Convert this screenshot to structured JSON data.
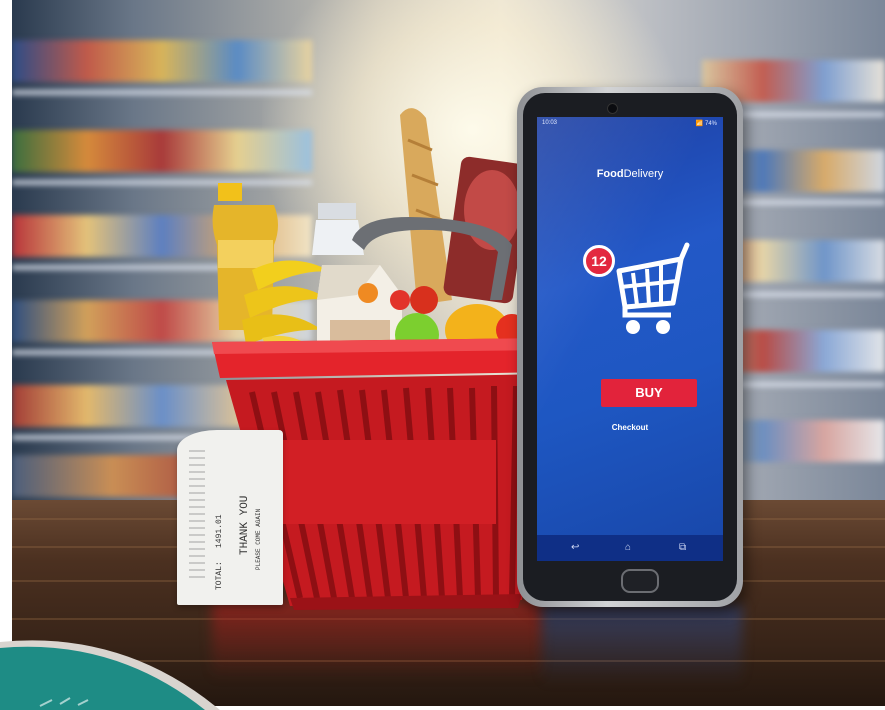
{
  "phone_screen": {
    "status_time": "10:03",
    "status_icons": "📶 74%",
    "app_title_bold": "Food",
    "app_title_rest": "Delivery",
    "cart_badge_count": "12",
    "buy_label": "BUY",
    "checkout_label": "Checkout",
    "nav_back_icon": "↩",
    "nav_home_icon": "⌂",
    "nav_recents_icon": "⧉"
  },
  "receipt": {
    "thank_you": "THANK YOU",
    "please_come_again": "PLEASE COME AGAIN",
    "total_label": "TOTAL:",
    "total_value": "1491.01"
  },
  "colors": {
    "basket_red": "#d81e24",
    "screen_blue": "#2358c7",
    "buy_red": "#e2233b",
    "teal_overlay": "#1e8c85"
  }
}
